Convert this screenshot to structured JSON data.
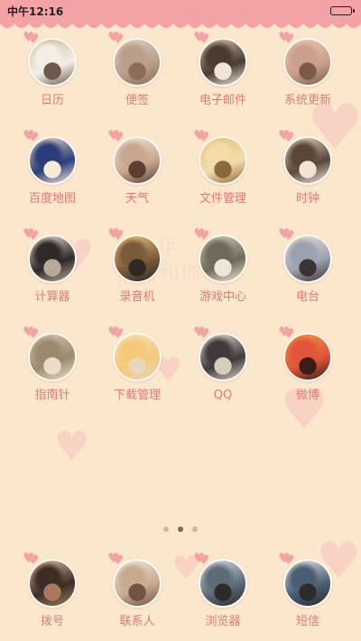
{
  "status_bar": {
    "time": "中午12:16"
  },
  "wallpaper": {
    "quote_line1": "“ 光年",
    "quote_line2": "只有和你 心”"
  },
  "apps": [
    {
      "label": "日历",
      "colors": [
        "#cfb79e",
        "#f3efe6",
        "#6e5a48"
      ]
    },
    {
      "label": "便签",
      "colors": [
        "#e9d0c2",
        "#b89f8a",
        "#8d6d5a"
      ]
    },
    {
      "label": "电子邮件",
      "colors": [
        "#d7c3a6",
        "#4a3b33",
        "#efe6d6"
      ]
    },
    {
      "label": "系统更新",
      "colors": [
        "#e8c9b6",
        "#caa08c",
        "#7b5a4a"
      ]
    },
    {
      "label": "百度地图",
      "colors": [
        "#f2dbc8",
        "#2a3d7a",
        "#f7ead9"
      ]
    },
    {
      "label": "天气",
      "colors": [
        "#efe7dc",
        "#c9a78e",
        "#5a4033"
      ]
    },
    {
      "label": "文件管理",
      "colors": [
        "#e6c07a",
        "#f3dcaa",
        "#8a6a3a"
      ]
    },
    {
      "label": "时钟",
      "colors": [
        "#e6d7c4",
        "#5a473a",
        "#f0e4d4"
      ]
    },
    {
      "label": "计算器",
      "colors": [
        "#ece4d8",
        "#2e2a2a",
        "#b8a898"
      ]
    },
    {
      "label": "录音机",
      "colors": [
        "#f1c97e",
        "#7a5a3a",
        "#2e2a26"
      ]
    },
    {
      "label": "游戏中心",
      "colors": [
        "#cfd2b8",
        "#6c6a58",
        "#eee7d6"
      ]
    },
    {
      "label": "电台",
      "colors": [
        "#e9e0d4",
        "#9aa1b0",
        "#3a3433"
      ]
    },
    {
      "label": "指南针",
      "colors": [
        "#d8c8ac",
        "#9b8b6e",
        "#e9ddc7"
      ]
    },
    {
      "label": "下载管理",
      "colors": [
        "#f6e1b9",
        "#f4c97a",
        "#e8d6bd"
      ]
    },
    {
      "label": "QQ",
      "colors": [
        "#ece5dc",
        "#3f3a3a",
        "#d6cdbf"
      ]
    },
    {
      "label": "微博",
      "colors": [
        "#f09a3f",
        "#e0543a",
        "#3a1c18"
      ]
    }
  ],
  "page_dots": [
    {
      "active": false
    },
    {
      "active": true
    },
    {
      "active": false
    }
  ],
  "dock": [
    {
      "label": "拨号",
      "colors": [
        "#e6c29a",
        "#3c2d26",
        "#a67a5a"
      ]
    },
    {
      "label": "联系人",
      "colors": [
        "#f1e9de",
        "#c9a98f",
        "#6e5544"
      ]
    },
    {
      "label": "浏览器",
      "colors": [
        "#d9dde0",
        "#5c6b76",
        "#2e2a2a"
      ]
    },
    {
      "label": "短信",
      "colors": [
        "#e9eaea",
        "#4a5d72",
        "#2c2b2e"
      ]
    }
  ]
}
